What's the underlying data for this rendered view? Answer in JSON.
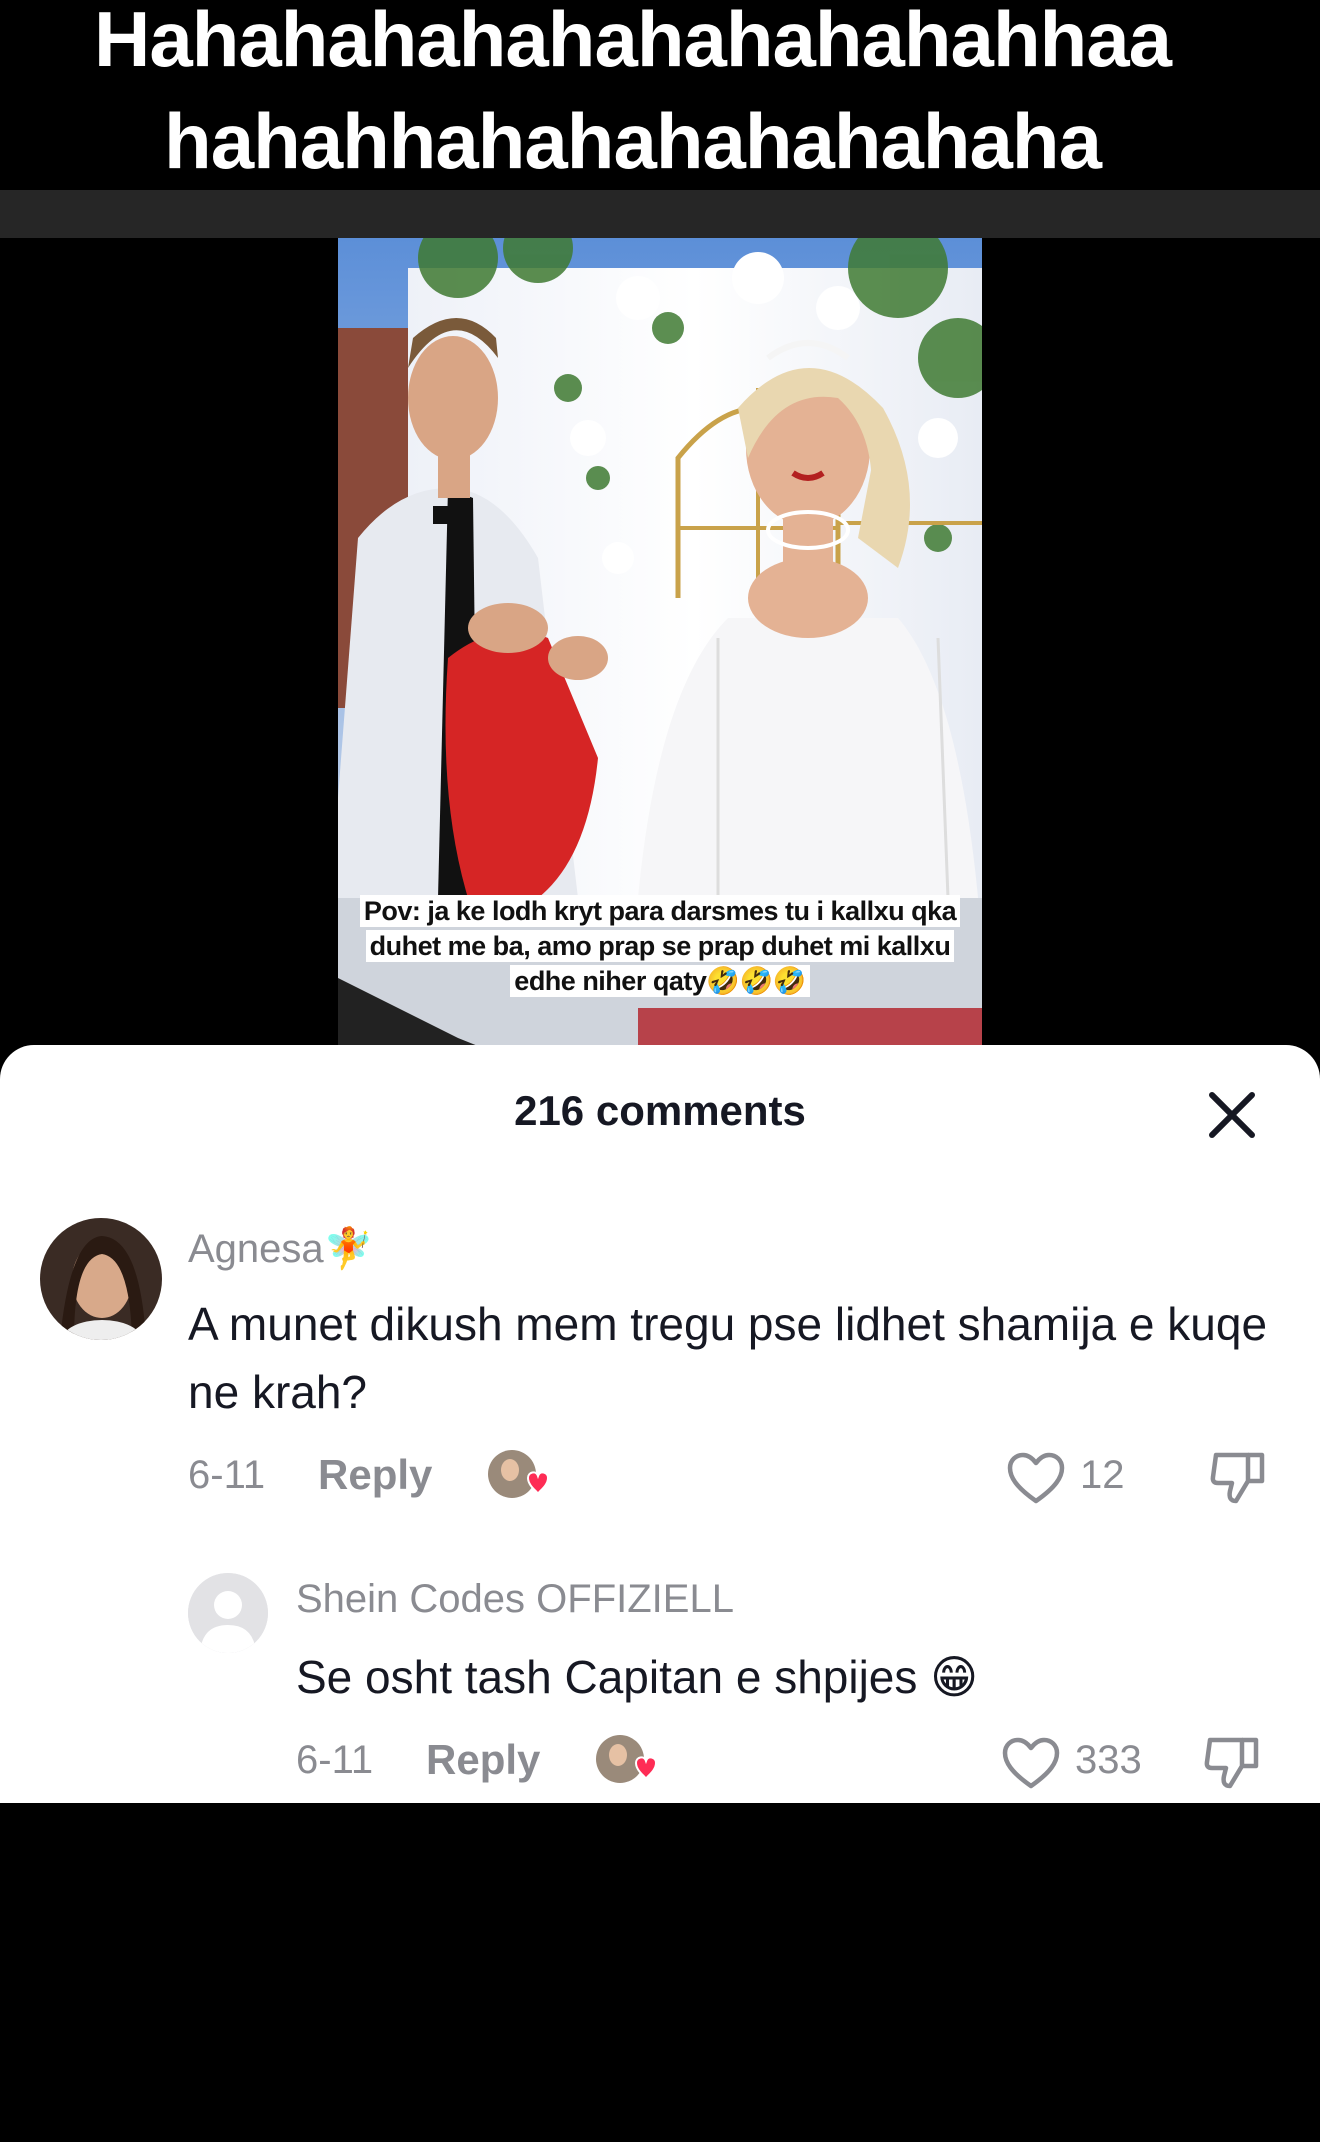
{
  "caption": {
    "line1": "Hahahahahahahahahahahhaa",
    "line2": "hahahhahahahahahahaha"
  },
  "video": {
    "caption_lines": [
      "Pov: ja ke lodh kryt para darsmes tu i kallxu qka",
      "duhet me ba, amo prap se prap duhet mi kallxu",
      "edhe niher qaty🤣🤣🤣"
    ]
  },
  "comments_sheet": {
    "title": "216 comments",
    "close_icon": "close-icon",
    "comments": [
      {
        "username": "Agnesa",
        "username_emoji": "🧚",
        "text": "A munet dikush mem tregu pse lidhet shamija e kuqe ne krah?",
        "date": "6-11",
        "reply_label": "Reply",
        "likes": "12"
      },
      {
        "username": "Shein Codes OFFIZIELL",
        "text": "Se osht tash Capitan e shpijes 😁",
        "date": "6-11",
        "reply_label": "Reply",
        "likes": "333"
      }
    ]
  },
  "colors": {
    "accent_heart": "#fe2c55",
    "muted_text": "#8a8b91",
    "primary_text": "#161823"
  }
}
